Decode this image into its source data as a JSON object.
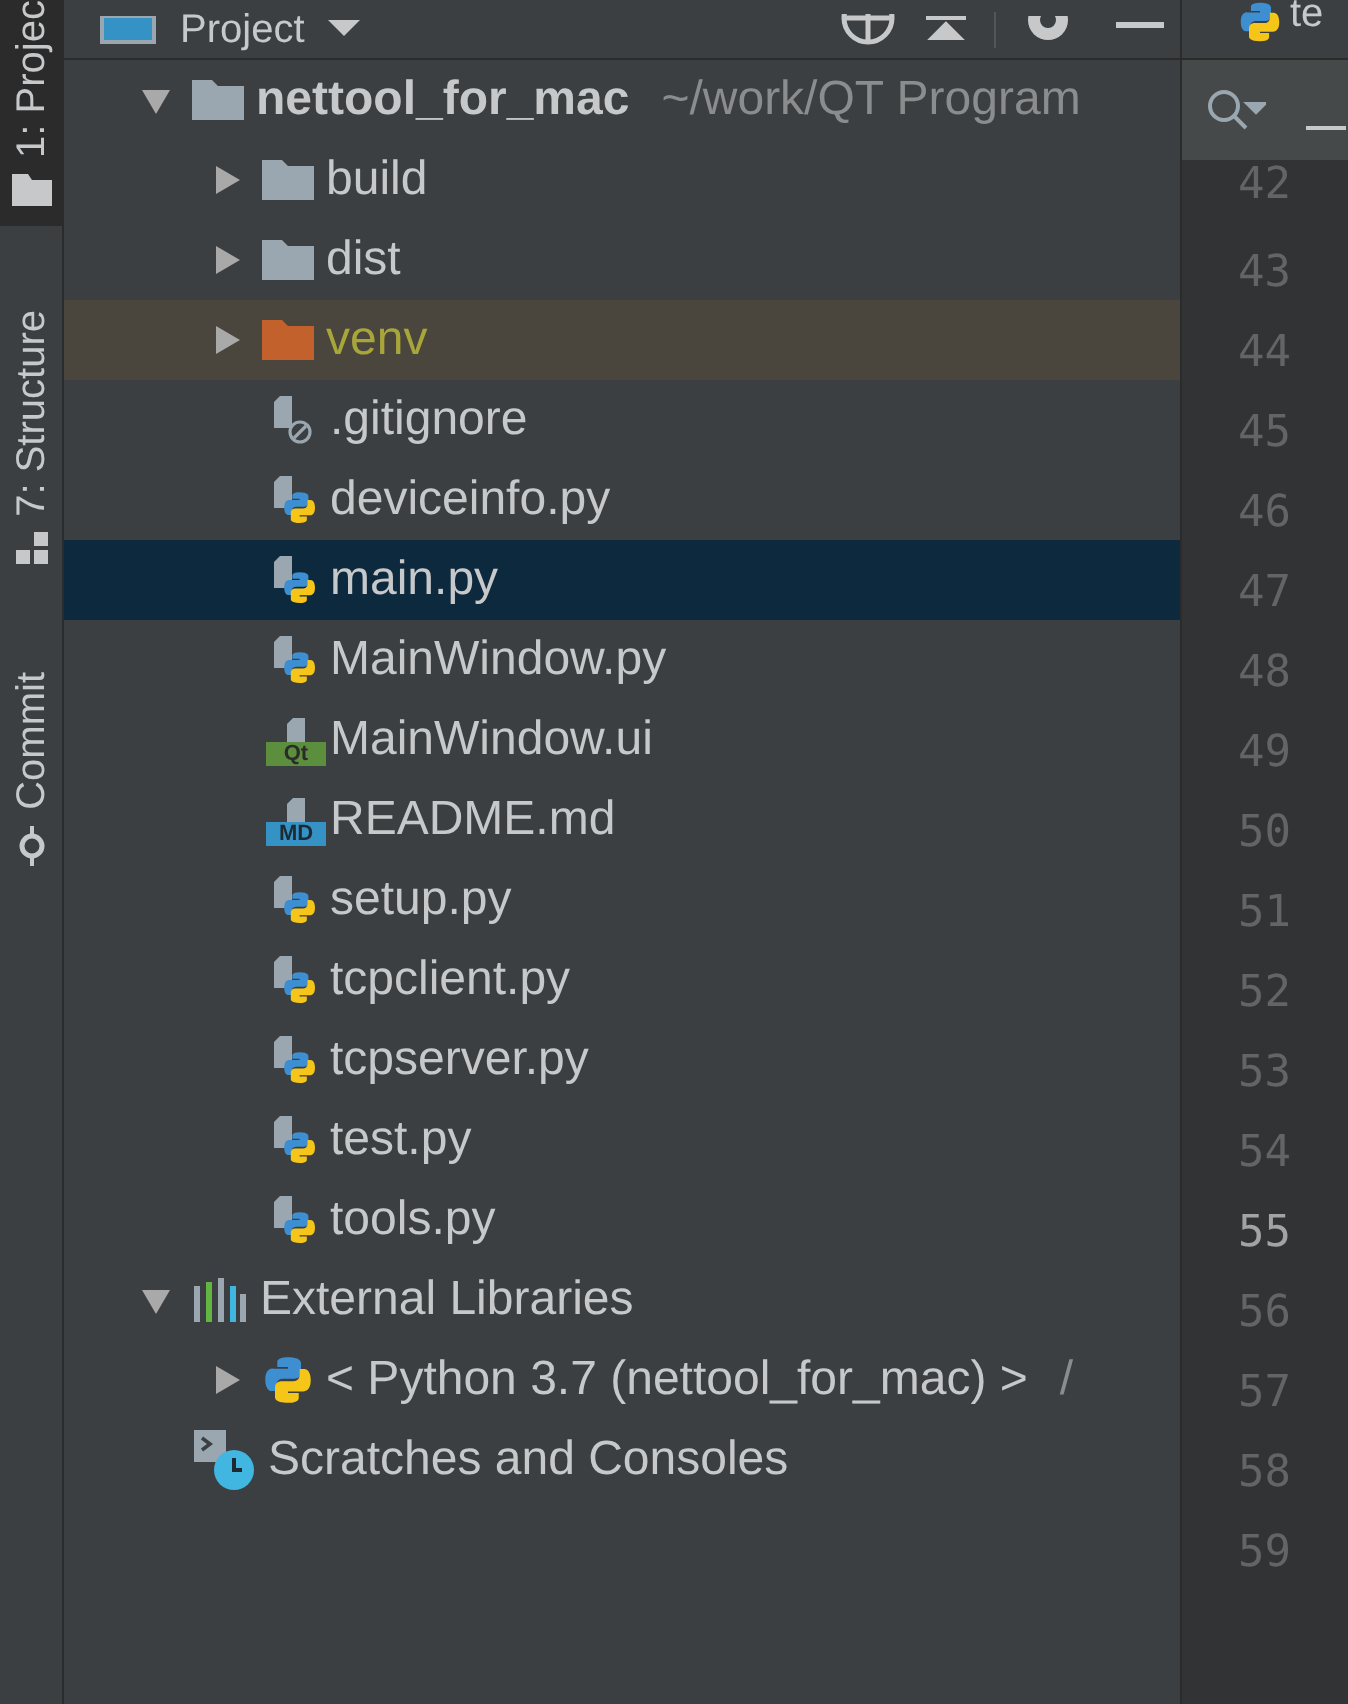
{
  "tool_strip": [
    {
      "label": "1: Projec",
      "selected": true
    },
    {
      "label": "7: Structure",
      "selected": false
    },
    {
      "label": "Commit",
      "selected": false
    }
  ],
  "panel": {
    "title": "Project"
  },
  "tree": [
    {
      "kind": "folder",
      "label": "nettool_for_mac",
      "hint": "~/work/QT Program",
      "expanded": true,
      "selected": false,
      "excluded": false,
      "children": [
        {
          "kind": "folder",
          "label": "build",
          "expanded": false,
          "selected": false,
          "excluded": false
        },
        {
          "kind": "folder",
          "label": "dist",
          "expanded": false,
          "selected": false,
          "excluded": false
        },
        {
          "kind": "folder",
          "label": "venv",
          "expanded": false,
          "selected": false,
          "excluded": true
        },
        {
          "kind": "ignore",
          "label": ".gitignore",
          "selected": false
        },
        {
          "kind": "python",
          "label": "deviceinfo.py",
          "selected": false
        },
        {
          "kind": "python",
          "label": "main.py",
          "selected": true
        },
        {
          "kind": "python",
          "label": "MainWindow.py",
          "selected": false
        },
        {
          "kind": "qt",
          "badge": "Qt",
          "label": "MainWindow.ui",
          "selected": false
        },
        {
          "kind": "md",
          "badge": "MD",
          "label": "README.md",
          "selected": false
        },
        {
          "kind": "python",
          "label": "setup.py",
          "selected": false
        },
        {
          "kind": "python",
          "label": "tcpclient.py",
          "selected": false
        },
        {
          "kind": "python",
          "label": "tcpserver.py",
          "selected": false
        },
        {
          "kind": "python",
          "label": "test.py",
          "selected": false
        },
        {
          "kind": "python",
          "label": "tools.py",
          "selected": false
        }
      ]
    },
    {
      "kind": "libraries",
      "label": "External Libraries",
      "expanded": true,
      "selected": false,
      "children": [
        {
          "kind": "sdk",
          "label": "< Python 3.7 (nettool_for_mac) >",
          "hint": "/",
          "expanded": false,
          "selected": false
        }
      ]
    },
    {
      "kind": "scratches",
      "label": "Scratches and Consoles",
      "selected": false
    }
  ],
  "editor": {
    "tab": "te",
    "lines": [
      {
        "number": "42",
        "current": false
      },
      {
        "number": "43",
        "current": false
      },
      {
        "number": "44",
        "current": false
      },
      {
        "number": "45",
        "current": false
      },
      {
        "number": "46",
        "current": false
      },
      {
        "number": "47",
        "current": false
      },
      {
        "number": "48",
        "current": false
      },
      {
        "number": "49",
        "current": false
      },
      {
        "number": "50",
        "current": false
      },
      {
        "number": "51",
        "current": false
      },
      {
        "number": "52",
        "current": false
      },
      {
        "number": "53",
        "current": false
      },
      {
        "number": "54",
        "current": false
      },
      {
        "number": "55",
        "current": true
      },
      {
        "number": "56",
        "current": false
      },
      {
        "number": "57",
        "current": false
      },
      {
        "number": "58",
        "current": false
      },
      {
        "number": "59",
        "current": false
      }
    ]
  }
}
